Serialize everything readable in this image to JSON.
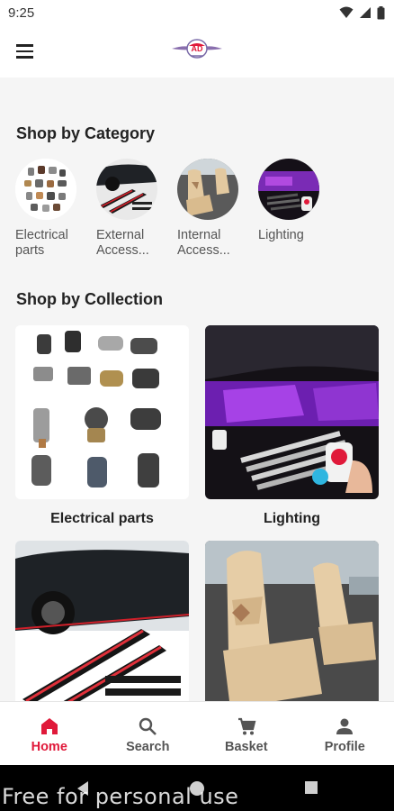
{
  "status_bar": {
    "time": "9:25"
  },
  "app_bar": {
    "logo_text": "AD"
  },
  "sections": {
    "category_title": "Shop by Category",
    "collection_title": "Shop by Collection"
  },
  "categories": [
    {
      "label": "Electrical parts",
      "icon": "electrical-parts-image"
    },
    {
      "label": "External Access...",
      "icon": "external-accessories-image"
    },
    {
      "label": "Internal Access...",
      "icon": "internal-accessories-image"
    },
    {
      "label": "Lighting",
      "icon": "lighting-image"
    }
  ],
  "collections": [
    {
      "label": "Electrical parts",
      "icon": "electrical-parts-image"
    },
    {
      "label": "Lighting",
      "icon": "lighting-image"
    },
    {
      "label": "",
      "icon": "external-accessories-image"
    },
    {
      "label": "",
      "icon": "internal-accessories-image"
    }
  ],
  "bottom_nav": [
    {
      "label": "Home",
      "icon": "home-icon",
      "active": true
    },
    {
      "label": "Search",
      "icon": "search-icon",
      "active": false
    },
    {
      "label": "Basket",
      "icon": "cart-icon",
      "active": false
    },
    {
      "label": "Profile",
      "icon": "person-icon",
      "active": false
    }
  ],
  "watermark": "Free for personal use",
  "colors": {
    "accent": "#e0193a",
    "background": "#f5f5f5"
  }
}
